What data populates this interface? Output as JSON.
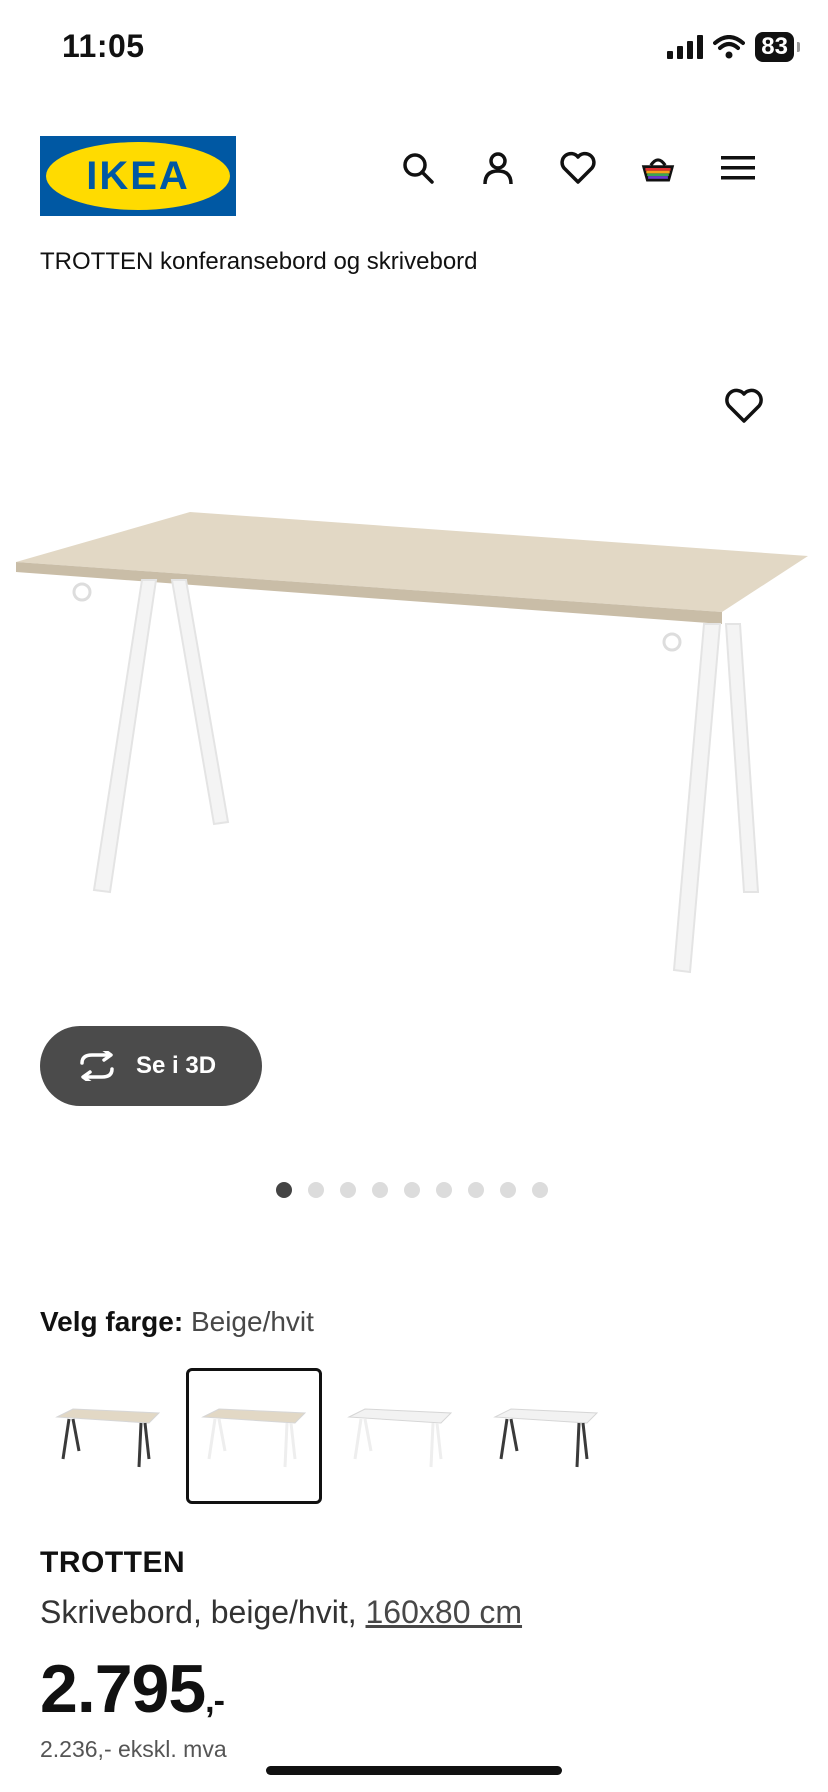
{
  "status": {
    "time": "11:05",
    "battery": "83"
  },
  "header": {
    "logo_text": "IKEA",
    "icons": [
      "search-icon",
      "user-icon",
      "heart-icon",
      "cart-icon",
      "menu-icon"
    ]
  },
  "breadcrumb": "TROTTEN konferansebord og skrivebord",
  "gallery": {
    "view3d_label": "Se i 3D",
    "dots_count": 9,
    "active_dot": 0
  },
  "color": {
    "label": "Velg farge:",
    "value": "Beige/hvit",
    "swatches": [
      {
        "top": "#e2d8c5",
        "legs": "#3a3a3a",
        "selected": false
      },
      {
        "top": "#e2d8c5",
        "legs": "#eeeeee",
        "selected": true
      },
      {
        "top": "#f2f2f2",
        "legs": "#eeeeee",
        "selected": false
      },
      {
        "top": "#f2f2f2",
        "legs": "#3a3a3a",
        "selected": false
      }
    ]
  },
  "product": {
    "name": "TROTTEN",
    "description": "Skrivebord, beige/hvit, ",
    "size": "160x80 cm",
    "price": "2.795",
    "price_suffix": ",-",
    "price_ex_vat": "2.236,- ekskl. mva"
  },
  "colors": {
    "ikea_blue": "#0058a3",
    "ikea_yellow": "#ffdb00",
    "button_dark": "#4b4b4b"
  }
}
